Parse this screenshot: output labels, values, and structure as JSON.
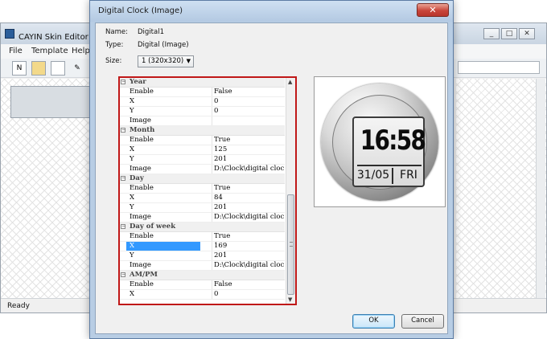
{
  "main_window": {
    "title": "CAYIN Skin Editor - 未",
    "menu": [
      "File",
      "Template",
      "Help"
    ],
    "status": "Ready",
    "window_buttons": [
      "_",
      "□",
      "✕"
    ]
  },
  "dialog": {
    "title": "Digital Clock (Image)",
    "close_glyph": "✕",
    "name_label": "Name:",
    "name_value": "Digital1",
    "type_label": "Type:",
    "type_value": "Digital (Image)",
    "size_label": "Size:",
    "size_value": "1  (320x320)",
    "ok_label": "OK",
    "cancel_label": "Cancel"
  },
  "properties": [
    {
      "kind": "category",
      "name": "Year"
    },
    {
      "kind": "prop",
      "name": "Enable",
      "value": "False"
    },
    {
      "kind": "prop",
      "name": "X",
      "value": "0"
    },
    {
      "kind": "prop",
      "name": "Y",
      "value": "0"
    },
    {
      "kind": "prop",
      "name": "Image",
      "value": ""
    },
    {
      "kind": "category",
      "name": "Month"
    },
    {
      "kind": "prop",
      "name": "Enable",
      "value": "True"
    },
    {
      "kind": "prop",
      "name": "X",
      "value": "125"
    },
    {
      "kind": "prop",
      "name": "Y",
      "value": "201"
    },
    {
      "kind": "prop",
      "name": "Image",
      "value": "D:\\Clock\\digital clock\\M..."
    },
    {
      "kind": "category",
      "name": "Day"
    },
    {
      "kind": "prop",
      "name": "Enable",
      "value": "True"
    },
    {
      "kind": "prop",
      "name": "X",
      "value": "84"
    },
    {
      "kind": "prop",
      "name": "Y",
      "value": "201"
    },
    {
      "kind": "prop",
      "name": "Image",
      "value": "D:\\Clock\\digital clock\\M..."
    },
    {
      "kind": "category",
      "name": "Day of week"
    },
    {
      "kind": "prop",
      "name": "Enable",
      "value": "True"
    },
    {
      "kind": "prop",
      "name": "X",
      "value": "169",
      "selected": true
    },
    {
      "kind": "prop",
      "name": "Y",
      "value": "201"
    },
    {
      "kind": "prop",
      "name": "Image",
      "value": "D:\\Clock\\digital clock\\M..."
    },
    {
      "kind": "category",
      "name": "AM/PM"
    },
    {
      "kind": "prop",
      "name": "Enable",
      "value": "False"
    },
    {
      "kind": "prop",
      "name": "X",
      "value": "0"
    }
  ],
  "preview": {
    "time": "16:58",
    "date": "31/05",
    "weekday": "FRI"
  },
  "colors": {
    "selection": "#3399ff",
    "highlight_border": "#c01818",
    "dialog_frame": "#b8cde4"
  }
}
